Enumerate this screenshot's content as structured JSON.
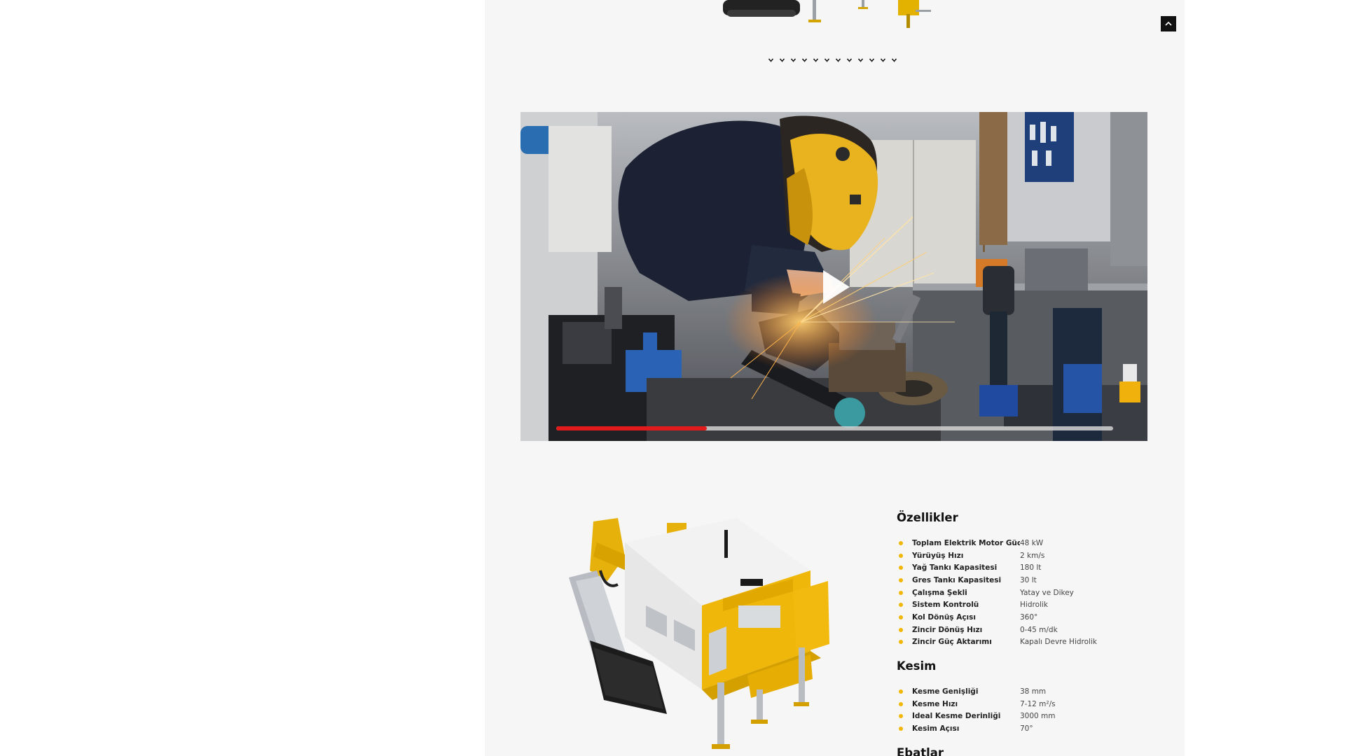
{
  "colors": {
    "accent": "#f2b705",
    "progress": "#e11b1b",
    "panel_bg": "#f6f6f6"
  },
  "navigation": {
    "scroll_top_icon": "chevron-up-icon",
    "dot_icon": "chevron-down-icon",
    "dot_count": 12
  },
  "video": {
    "play_icon": "play-icon",
    "progress_fraction": 0.27
  },
  "specs": {
    "features": {
      "title": "Özellikler",
      "items": [
        {
          "label": "Toplam Elektrik Motor Gücü",
          "value": "48 kW"
        },
        {
          "label": "Yürüyüş Hızı",
          "value": "2 km/s"
        },
        {
          "label": "Yağ Tankı Kapasitesi",
          "value": "180 lt"
        },
        {
          "label": "Gres Tankı Kapasitesi",
          "value": "30 lt"
        },
        {
          "label": "Çalışma Şekli",
          "value": "Yatay ve Dikey"
        },
        {
          "label": "Sistem Kontrolü",
          "value": "Hidrolik"
        },
        {
          "label": "Kol Dönüş Açısı",
          "value": "360°"
        },
        {
          "label": "Zincir Dönüş Hızı",
          "value": "0-45 m/dk"
        },
        {
          "label": "Zincir Güç Aktarımı",
          "value": "Kapalı Devre Hidrolik"
        }
      ]
    },
    "cutting": {
      "title": "Kesim",
      "items": [
        {
          "label": "Kesme Genişliği",
          "value": "38 mm"
        },
        {
          "label": "Kesme Hızı",
          "value": "7-12 m²/s"
        },
        {
          "label": "İdeal Kesme Derinliği",
          "value": "3000 mm"
        },
        {
          "label": "Kesim Açısı",
          "value": "70°"
        }
      ]
    },
    "dimensions": {
      "title": "Ebatlar"
    }
  }
}
